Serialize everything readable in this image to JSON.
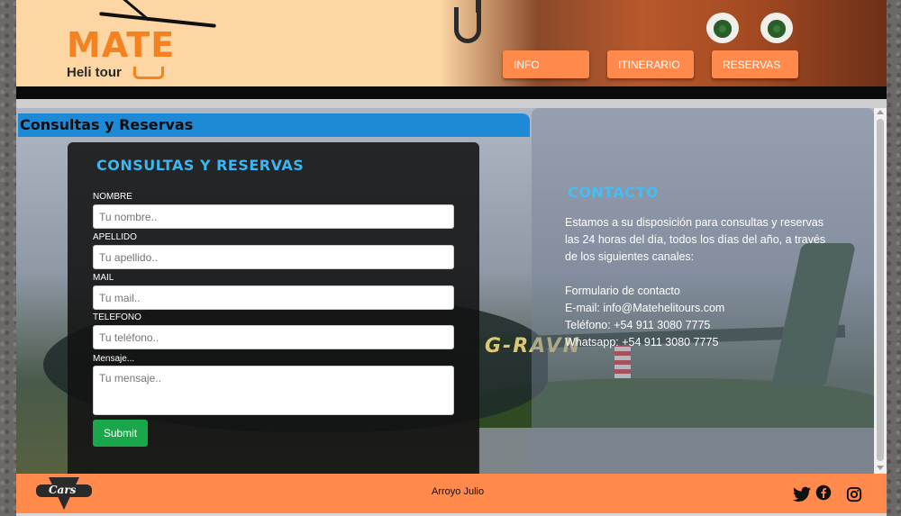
{
  "header": {
    "logo_main": "MATE",
    "logo_sub": "Heli tour",
    "nav": [
      {
        "label": "INFO"
      },
      {
        "label": "ITINERARIO"
      },
      {
        "label": "RESERVAS"
      }
    ]
  },
  "section_title": "Consultas y Reservas",
  "form": {
    "heading": "CONSULTAS Y RESERVAS",
    "fields": [
      {
        "label": "NOMBRE",
        "placeholder": "Tu nombre.."
      },
      {
        "label": "APELLIDO",
        "placeholder": "Tu apellido.."
      },
      {
        "label": "MAIL",
        "placeholder": "Tu mail.."
      },
      {
        "label": "TELEFONO",
        "placeholder": "Tu teléfono.."
      }
    ],
    "message": {
      "label": "Mensaje...",
      "placeholder": "Tu mensaje.."
    },
    "submit_label": "Submit"
  },
  "contact": {
    "title": "CONTACTO",
    "intro": "Estamos a su disposición para consultas y reservas las 24 horas del día, todos los días del año, a través de los siguientes canales:",
    "lines": [
      "Formulario de contacto",
      "E-mail: info@Matehelitours.com",
      "Teléfono: +54 911 3080 7775",
      "Whatsapp: +54 911 3080 7775"
    ]
  },
  "background": {
    "registration": "G-RAVN"
  },
  "footer": {
    "brand_logo_text": "Cars",
    "author": "Arroyo Julio",
    "social_icons": [
      "twitter-icon",
      "facebook-icon",
      "instagram-icon"
    ]
  },
  "colors": {
    "accent_orange": "#ff8a4c",
    "header_bg": "#fdd6a4",
    "title_blue": "#1e8ad6",
    "heading_cyan": "#3cb6f0",
    "submit_green": "#1aa64a"
  }
}
